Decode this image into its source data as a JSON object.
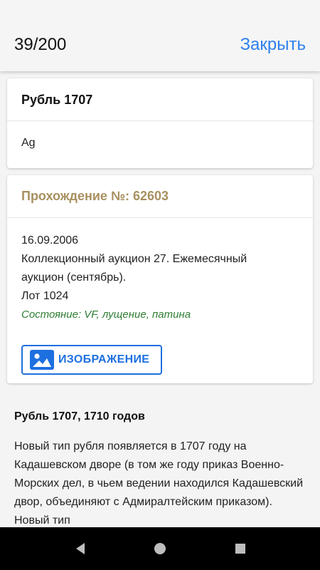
{
  "top_bar": {
    "counter": "39/200",
    "close_label": "Закрыть"
  },
  "coin_card": {
    "title": "Рубль 1707",
    "metal": "Ag"
  },
  "passage_card": {
    "title": "Прохождение №: 62603",
    "date": "16.09.2006",
    "auction_line1": "Коллекционный аукцион 27. Ежемесячный",
    "auction_line2": "аукцион (сентябрь).",
    "lot": "Лот 1024",
    "condition": "Состояние: VF, лущение, патина",
    "image_button_label": "ИЗОБРАЖЕНИЕ",
    "image_icon": "image-icon"
  },
  "article": {
    "title": "Рубль 1707, 1710 годов",
    "text": "Новый тип рубля появляется в 1707 году на Кадашевском дворе (в том же году приказ Военно-Морских дел, в чьем ведении находился Кадашевский двор, объединяют с Адмиралтейским приказом). Новый тип"
  },
  "nav_bar": {
    "back_icon": "back-triangle-icon",
    "home_icon": "home-circle-icon",
    "recents_icon": "recents-square-icon"
  },
  "colors": {
    "accent": "#2f80ed",
    "passage_title": "#a89060",
    "condition": "#2e7d32",
    "button_border": "#1e6fe0"
  }
}
